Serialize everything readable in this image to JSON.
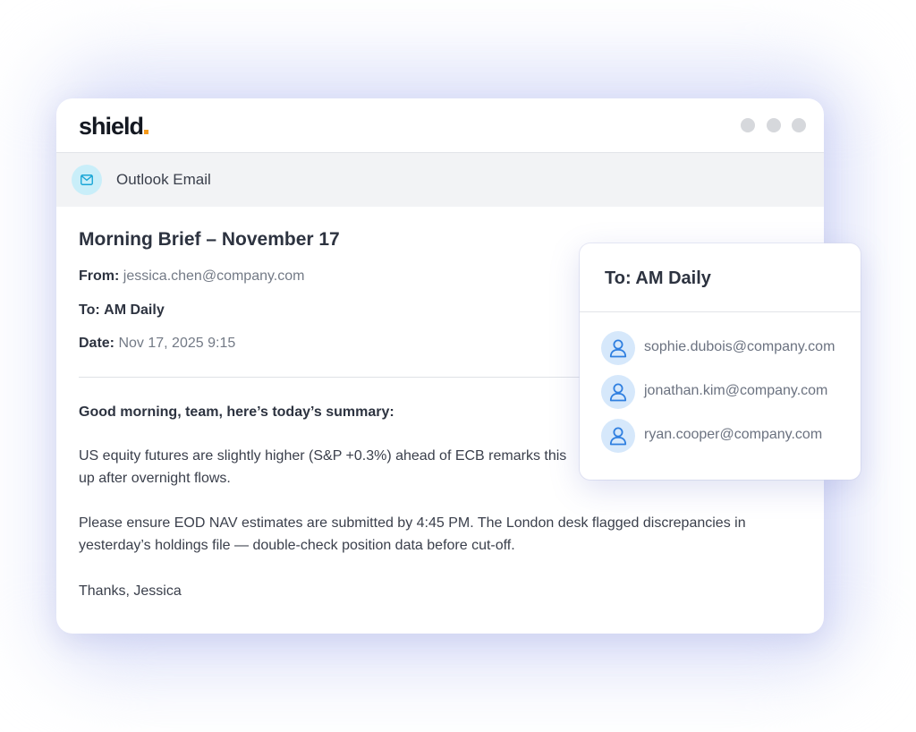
{
  "app": {
    "logo_text": "shield",
    "section_name": "Outlook Email",
    "section_icon": "mail-icon"
  },
  "email": {
    "subject": "Morning Brief – November 17",
    "from_label": "From:",
    "from_value": "jessica.chen@company.com",
    "to_label": "To:",
    "to_value": "AM Daily",
    "date_label": "Date:",
    "date_value": "Nov 17, 2025 9:15",
    "greeting": "Good morning, team, here’s today’s summary:",
    "paragraph1": "US equity futures are slightly higher (S&P +0.3%) ahead of ECB remarks this morning. Cash balances are up after overnight flows.",
    "paragraph1_line1": "US equity futures are slightly higher (S&P +0.3%) ahead of ECB remarks this",
    "paragraph1_line2": "up after overnight flows.",
    "paragraph2_line1": "Please ensure EOD NAV estimates are submitted by 4:45 PM.  The London desk flagged discrepancies in",
    "paragraph2_line2": "yesterday’s holdings file — double-check position data before cut-off.",
    "signoff": "Thanks, Jessica"
  },
  "popover": {
    "title": "To: AM Daily",
    "recipients": [
      {
        "email": "sophie.dubois@company.com",
        "icon": "user-icon"
      },
      {
        "email": "jonathan.kim@company.com",
        "icon": "user-icon"
      },
      {
        "email": "ryan.cooper@company.com",
        "icon": "user-icon"
      }
    ]
  },
  "colors": {
    "accent_orange": "#f59a1c",
    "mail_icon_bg": "#c9eef9",
    "mail_icon_stroke": "#1aa6d6",
    "avatar_bg": "#d6e8fb",
    "avatar_stroke": "#2f7fe0",
    "window_dots": "#d6d8dc"
  }
}
